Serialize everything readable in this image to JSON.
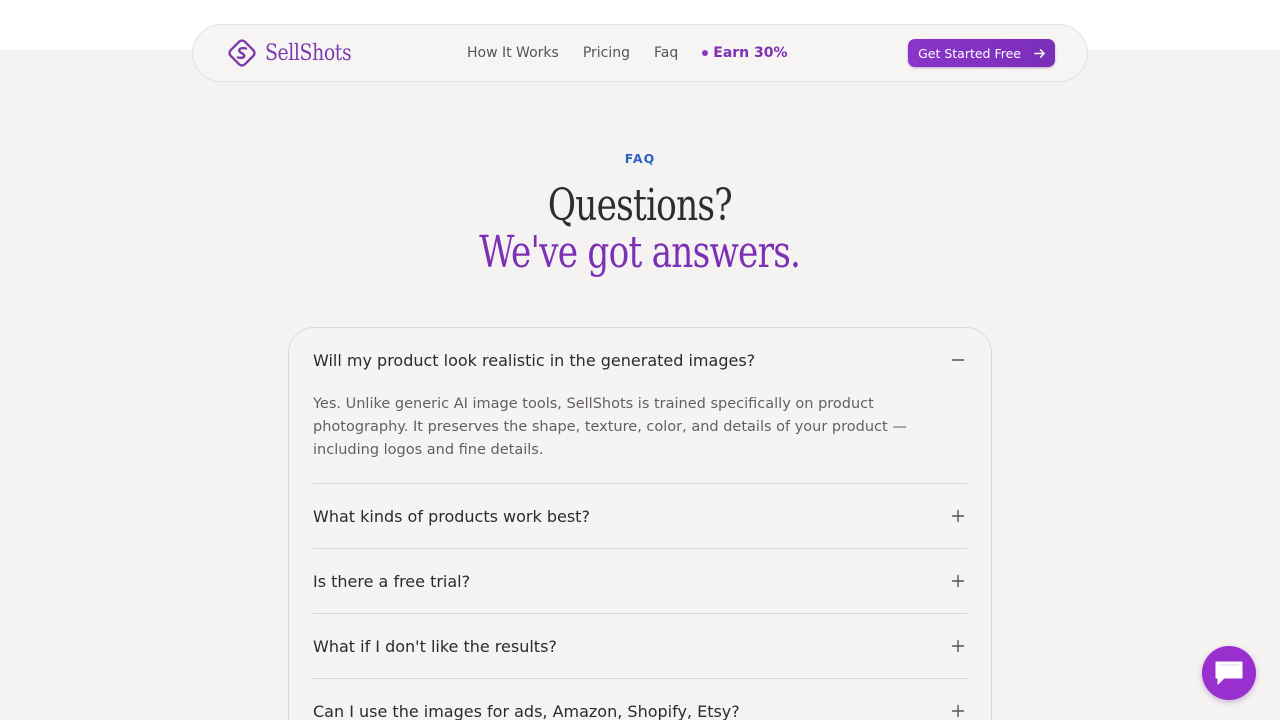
{
  "brand": {
    "name": "SellShots",
    "accent": "#7c3aad"
  },
  "nav": {
    "links": [
      "How It Works",
      "Pricing",
      "Faq"
    ],
    "earn_label": "Earn 30%",
    "cta_label": "Get Started Free"
  },
  "faq": {
    "eyebrow": "FAQ",
    "heading_line1": "Questions?",
    "heading_line2": "We've got answers.",
    "items": [
      {
        "question": "Will my product look realistic in the generated images?",
        "answer": "Yes. Unlike generic AI image tools, SellShots is trained specifically on product photography. It preserves the shape, texture, color, and details of your product — including logos and fine details.",
        "expanded": true
      },
      {
        "question": "What kinds of products work best?",
        "expanded": false
      },
      {
        "question": "Is there a free trial?",
        "expanded": false
      },
      {
        "question": "What if I don't like the results?",
        "expanded": false
      },
      {
        "question": "Can I use the images for ads, Amazon, Shopify, Etsy?",
        "expanded": false
      }
    ]
  },
  "chat": {
    "icon": "chat-bubble-icon",
    "color": "#9a2fd0"
  }
}
